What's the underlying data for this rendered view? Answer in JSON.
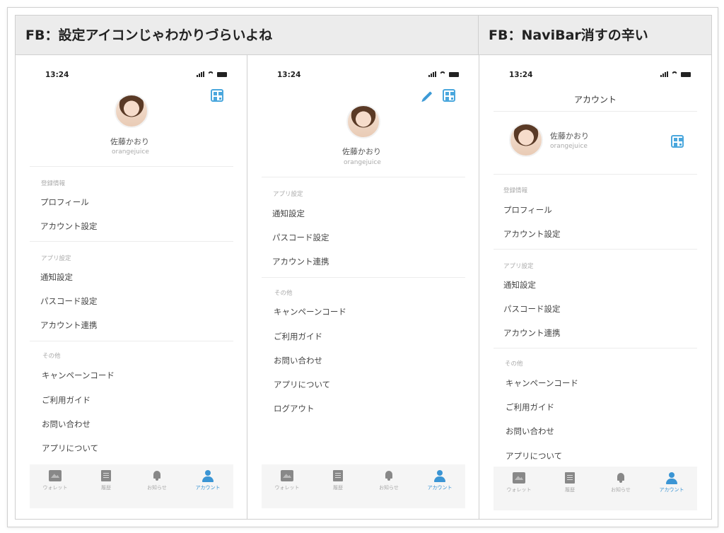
{
  "headers": {
    "left": "FB：設定アイコンじゃわかりづらいよね",
    "right": "FB：NaviBar消すの辛い"
  },
  "status_time": "13:24",
  "user": {
    "name": "佐藤かおり",
    "id": "orangejuice"
  },
  "sections": {
    "registration": "登録情報",
    "app_settings": "アプリ設定",
    "other": "その他"
  },
  "items": {
    "profile": "プロフィール",
    "account_settings": "アカウント設定",
    "notification_settings": "通知設定",
    "passcode_settings": "パスコード設定",
    "account_linking": "アカウント連携",
    "campaign_code": "キャンペーンコード",
    "user_guide": "ご利用ガイド",
    "contact": "お問い合わせ",
    "about_app": "アプリについて",
    "logout": "ログアウト"
  },
  "nav_title": "アカウント",
  "tabs": {
    "wallet": "ウォレット",
    "history": "履歴",
    "notifications": "お知らせ",
    "account": "アカウント"
  },
  "colors": {
    "accent": "#3b95d4",
    "header_bg": "#ececec"
  }
}
